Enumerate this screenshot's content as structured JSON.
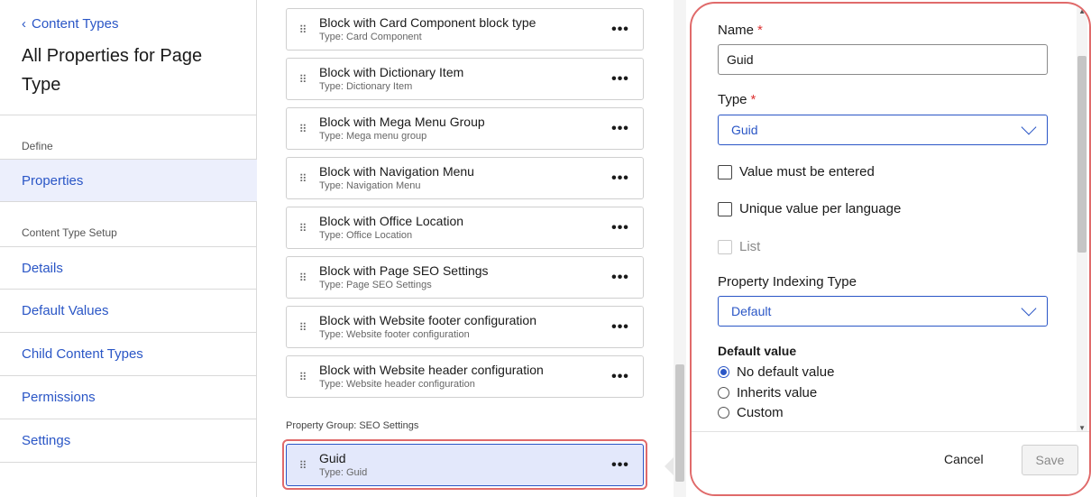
{
  "sidebar": {
    "back_label": "Content Types",
    "title": "All Properties for Page Type",
    "section_define": "Define",
    "section_setup": "Content Type Setup",
    "items": [
      {
        "label": "Properties"
      },
      {
        "label": "Details"
      },
      {
        "label": "Default Values"
      },
      {
        "label": "Child Content Types"
      },
      {
        "label": "Permissions"
      },
      {
        "label": "Settings"
      }
    ]
  },
  "blocks": [
    {
      "title": "Block with Card Component block type",
      "type": "Type: Card Component"
    },
    {
      "title": "Block with Dictionary Item",
      "type": "Type: Dictionary Item"
    },
    {
      "title": "Block with Mega Menu Group",
      "type": "Type: Mega menu group"
    },
    {
      "title": "Block with Navigation Menu",
      "type": "Type: Navigation Menu"
    },
    {
      "title": "Block with Office Location",
      "type": "Type: Office Location"
    },
    {
      "title": "Block with Page SEO Settings",
      "type": "Type: Page SEO Settings"
    },
    {
      "title": "Block with Website footer configuration",
      "type": "Type: Website footer configuration"
    },
    {
      "title": "Block with Website header configuration",
      "type": "Type: Website header configuration"
    }
  ],
  "group_label": "Property Group: SEO Settings",
  "selected_block": {
    "title": "Guid",
    "type": "Type: Guid"
  },
  "more_glyph": "•••",
  "grip_glyph": "⠿",
  "panel": {
    "name_label": "Name",
    "required_mark": "*",
    "name_value": "Guid",
    "type_label": "Type",
    "type_value": "Guid",
    "chk_required": "Value must be entered",
    "chk_unique": "Unique value per language",
    "chk_list": "List",
    "indexing_label": "Property Indexing Type",
    "indexing_value": "Default",
    "default_value_title": "Default value",
    "radio_none": "No default value",
    "radio_inherit": "Inherits value",
    "radio_custom": "Custom",
    "cancel_label": "Cancel",
    "save_label": "Save"
  },
  "colors": {
    "accent": "#2a56c6",
    "highlight": "#e06a6a",
    "active_bg": "#eceffc"
  }
}
